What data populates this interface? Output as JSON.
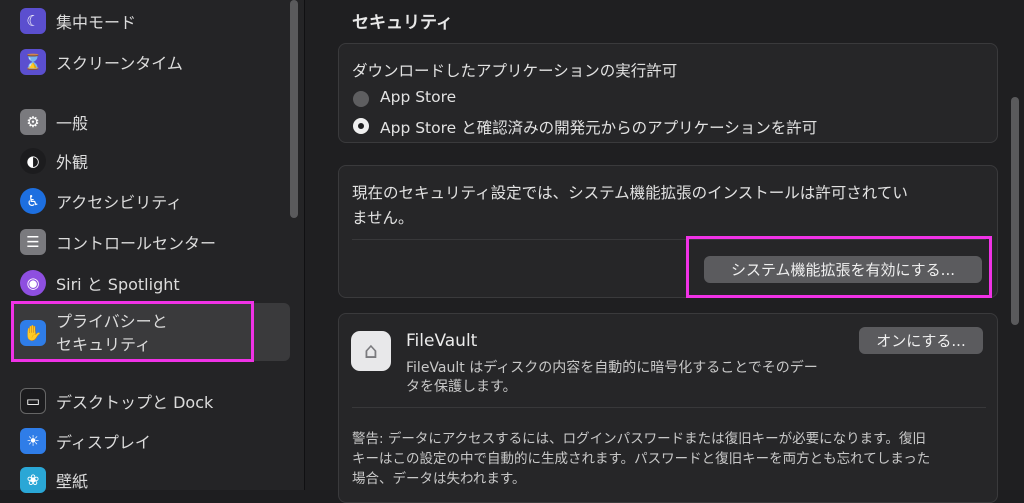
{
  "sidebar": {
    "items": [
      {
        "label": "集中モード",
        "icon": "moon-icon",
        "color": "#5b4fcf"
      },
      {
        "label": "スクリーンタイム",
        "icon": "hourglass-icon",
        "color": "#5b4fcf"
      },
      {
        "label": "一般",
        "icon": "gear-icon",
        "color": "#7a7a7e"
      },
      {
        "label": "外観",
        "icon": "appearance-icon",
        "color": "#1c1c1e"
      },
      {
        "label": "アクセシビリティ",
        "icon": "accessibility-icon",
        "color": "#1d6fe0"
      },
      {
        "label": "コントロールセンター",
        "icon": "toggles-icon",
        "color": "#7a7a7e"
      },
      {
        "label": "Siri と Spotlight",
        "icon": "siri-icon",
        "color": "#8e4fe0"
      },
      {
        "label": "プライバシーと",
        "label2": "セキュリティ",
        "icon": "hand-icon",
        "color": "#2f7de8"
      },
      {
        "label": "デスクトップと Dock",
        "icon": "dock-icon",
        "color": "#1c1c1e"
      },
      {
        "label": "ディスプレイ",
        "icon": "brightness-icon",
        "color": "#2f7de8"
      },
      {
        "label": "壁紙",
        "icon": "wallpaper-icon",
        "color": "#2aa7d6"
      }
    ]
  },
  "main": {
    "section_title": "セキュリティ",
    "download_card": {
      "heading": "ダウンロードしたアプリケーションの実行許可",
      "options": [
        "App Store",
        "App Store と確認済みの開発元からのアプリケーションを許可"
      ]
    },
    "extension_card": {
      "message_line1": "現在のセキュリティ設定では、システム機能拡張のインストールは許可されてい",
      "message_line2": "ません。",
      "button": "システム機能拡張を有効にする..."
    },
    "filevault_card": {
      "title": "FileVault",
      "desc_line1": "FileVault はディスクの内容を自動的に暗号化することでそのデー",
      "desc_line2": "タを保護します。",
      "button": "オンにする...",
      "warning_line1": "警告: データにアクセスするには、ログインパスワードまたは復旧キーが必要になります。復旧",
      "warning_line2": "キーはこの設定の中で自動的に生成されます。パスワードと復旧キーを両方とも忘れてしまった",
      "warning_line3": "場合、データは失われます。"
    }
  }
}
